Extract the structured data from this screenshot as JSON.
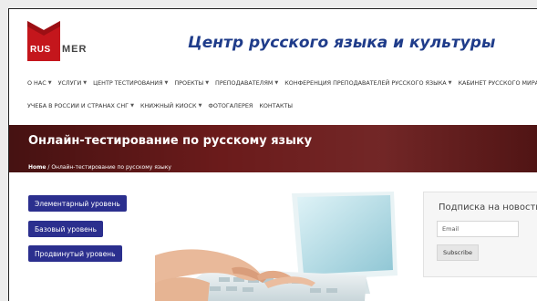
{
  "logo": {
    "left_text": "RUS",
    "right_text": "MER"
  },
  "header": {
    "title": "Центр русского языка и культуры"
  },
  "nav": {
    "row1": [
      {
        "label": "О НАС",
        "has_caret": true
      },
      {
        "label": "УСЛУГИ",
        "has_caret": true
      },
      {
        "label": "ЦЕНТР ТЕСТИРОВАНИЯ",
        "has_caret": true
      },
      {
        "label": "ПРОЕКТЫ",
        "has_caret": true
      },
      {
        "label": "ПРЕПОДАВАТЕЛЯМ",
        "has_caret": true
      },
      {
        "label": "КОНФЕРЕНЦИЯ ПРЕПОДАВАТЕЛЕЙ РУССКОГО ЯЗЫКА",
        "has_caret": true
      },
      {
        "label": "КАБИНЕТ РУССКОГО МИРА",
        "has_caret": false
      }
    ],
    "row2": [
      {
        "label": "УЧЕБА В РОССИИ И СТРАНАХ СНГ",
        "has_caret": true
      },
      {
        "label": "КНИЖНЫЙ КИОСК",
        "has_caret": true
      },
      {
        "label": "ФОТОГАЛЕРЕЯ",
        "has_caret": false
      },
      {
        "label": "КОНТАКТЫ",
        "has_caret": false
      }
    ],
    "caret_glyph": "▼"
  },
  "hero": {
    "title": "Онлайн-тестирование по русскому языку",
    "breadcrumb_home": "Home",
    "breadcrumb_sep": " / ",
    "breadcrumb_current": "Онлайн-тестирование по русскому языку"
  },
  "levels": {
    "elementary": "Элементарный уровень",
    "basic": "Базовый уровень",
    "advanced": "Продвинутый уровень"
  },
  "sidebar": {
    "heading": "Подписка на новости",
    "email_placeholder": "Email",
    "subscribe_label": "Subscribe"
  },
  "colors": {
    "brand_red": "#c4161c",
    "title_blue": "#1f3c8a",
    "hero_bg": "#6b1b1b",
    "button_blue": "#2b2f8e"
  }
}
